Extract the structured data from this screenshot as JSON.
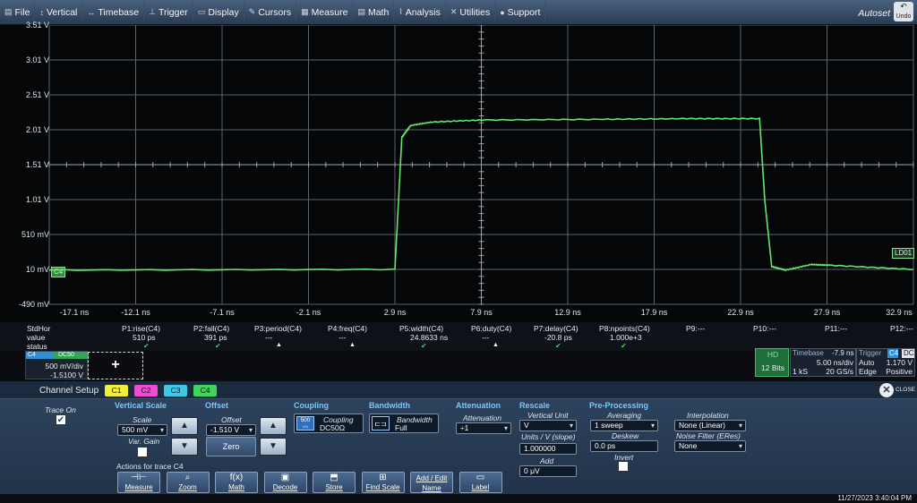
{
  "menubar": {
    "items": [
      {
        "icon": "file-icon",
        "glyph": "▤",
        "label": "File"
      },
      {
        "icon": "vertical-icon",
        "glyph": "↕",
        "label": "Vertical"
      },
      {
        "icon": "timebase-icon",
        "glyph": "↔",
        "label": "Timebase"
      },
      {
        "icon": "trigger-icon",
        "glyph": "⊥",
        "label": "Trigger"
      },
      {
        "icon": "display-icon",
        "glyph": "▭",
        "label": "Display"
      },
      {
        "icon": "cursors-icon",
        "glyph": "✎",
        "label": "Cursors"
      },
      {
        "icon": "measure-icon",
        "glyph": "▦",
        "label": "Measure"
      },
      {
        "icon": "math-icon",
        "glyph": "▤",
        "label": "Math"
      },
      {
        "icon": "analysis-icon",
        "glyph": "⌇",
        "label": "Analysis"
      },
      {
        "icon": "utilities-icon",
        "glyph": "✕",
        "label": "Utilities"
      },
      {
        "icon": "support-icon",
        "glyph": "●",
        "label": "Support"
      }
    ],
    "autoset": "Autoset",
    "undo": "Undo"
  },
  "grid": {
    "vlabels": [
      "3.51 V",
      "3.01 V",
      "2.51 V",
      "2.01 V",
      "1.51 V",
      "1.01 V",
      "510 mV",
      "10 mV",
      "-490 mV"
    ],
    "hlabels": [
      "-17.1 ns",
      "-12.1 ns",
      "-7.1 ns",
      "-2.1 ns",
      "2.9 ns",
      "7.9 ns",
      "12.9 ns",
      "17.9 ns",
      "22.9 ns",
      "27.9 ns",
      "32.9 ns"
    ],
    "trace_color": "#5fe86b",
    "marker_left": "C4",
    "marker_right": "LD01"
  },
  "trace": {
    "channel": "C4",
    "x_ns": [
      -17.1,
      2.9,
      3.3,
      3.8,
      5.0,
      7.9,
      15.0,
      20.0,
      24.0,
      24.3,
      24.7,
      25.5,
      27.0,
      28.0,
      32.9
    ],
    "y_v": [
      0.0,
      0.01,
      1.9,
      2.07,
      2.12,
      2.15,
      2.16,
      2.17,
      2.17,
      1.0,
      0.05,
      0.0,
      0.08,
      0.07,
      0.01
    ]
  },
  "measurements": {
    "row_labels": [
      "StdHor",
      "value",
      "status"
    ],
    "params": [
      {
        "name": "P1:rise(C4)",
        "value": "510 ps",
        "status": "check"
      },
      {
        "name": "P2:fall(C4)",
        "value": "391 ps",
        "status": "check"
      },
      {
        "name": "P3:period(C4)",
        "value": "---",
        "status": "triangle"
      },
      {
        "name": "P4:freq(C4)",
        "value": "---",
        "status": "triangle"
      },
      {
        "name": "P5:width(C4)",
        "value": "24.8633 ns",
        "status": "check"
      },
      {
        "name": "P6:duty(C4)",
        "value": "---",
        "status": "triangle"
      },
      {
        "name": "P7:delay(C4)",
        "value": "-20.8 ps",
        "status": "check"
      },
      {
        "name": "P8:npoints(C4)",
        "value": "1.000e+3",
        "status": "check"
      },
      {
        "name": "P9:---",
        "value": "",
        "status": ""
      },
      {
        "name": "P10:---",
        "value": "",
        "status": ""
      },
      {
        "name": "P11:---",
        "value": "",
        "status": ""
      },
      {
        "name": "P12:---",
        "value": "",
        "status": ""
      }
    ]
  },
  "channel_descriptor": {
    "name": "C4",
    "coupling": "DC50",
    "scale": "500 mV/div",
    "offset": "-1.5100 V",
    "add": "+"
  },
  "timebase": {
    "hd": "HD",
    "bits": "12 Bits",
    "title": "Timebase",
    "delay": "-7.9 ns",
    "per_div": "5.00 ns/div",
    "points": "1 kS",
    "rate": "20 GS/s",
    "trigger_title": "Trigger",
    "trigger_ch": "C4",
    "trigger_coupling": "DC",
    "trigger_mode": "Auto",
    "trigger_level": "1.170 V",
    "trigger_type": "Edge",
    "trigger_slope": "Positive"
  },
  "panel": {
    "title": "Channel Setup",
    "tabs": [
      {
        "label": "C1",
        "color": "#f2ef3a"
      },
      {
        "label": "C2",
        "color": "#f04bd6"
      },
      {
        "label": "C3",
        "color": "#3fc7e8"
      },
      {
        "label": "C4",
        "color": "#3fd45e"
      }
    ],
    "close_label": "CLOSE",
    "trace_on_label": "Trace On",
    "vertical_scale": {
      "title": "Vertical Scale",
      "scale_label": "Scale",
      "scale_value": "500 mV",
      "var_gain_label": "Var. Gain"
    },
    "offset": {
      "title": "Offset",
      "offset_label": "Offset",
      "offset_value": "-1.510 V",
      "zero_label": "Zero"
    },
    "coupling": {
      "title": "Coupling",
      "icon_label": "500",
      "label": "Coupling",
      "value": "DC50Ω"
    },
    "bandwidth": {
      "title": "Bandwidth",
      "label": "Bandwidth",
      "value": "Full"
    },
    "attenuation": {
      "title": "Attenuation",
      "label": "Attenuation",
      "value": "÷1"
    },
    "rescale": {
      "title": "Rescale",
      "unit_label": "Vertical Unit",
      "unit_value": "V",
      "slope_label": "Units / V (slope)",
      "slope_value": "1.000000",
      "add_label": "Add",
      "add_value": "0 μV"
    },
    "preprocessing": {
      "title": "Pre-Processing",
      "averaging_label": "Averaging",
      "averaging_value": "1 sweep",
      "deskew_label": "Deskew",
      "deskew_value": "0.0 ps",
      "invert_label": "Invert",
      "interp_label": "Interpolation",
      "interp_value": "None (Linear)",
      "noise_label": "Noise Filter (ERes)",
      "noise_value": "None"
    },
    "actions_label": "Actions for trace C4",
    "actions": [
      {
        "icon": "measure-icon",
        "glyph": "⊣⊢",
        "label": "Measure"
      },
      {
        "icon": "zoom-icon",
        "glyph": "⌕",
        "label": "Zoom"
      },
      {
        "icon": "math-icon",
        "glyph": "f(x)",
        "label": "Math"
      },
      {
        "icon": "decode-icon",
        "glyph": "▣",
        "label": "Decode"
      },
      {
        "icon": "store-icon",
        "glyph": "⬒",
        "label": "Store"
      },
      {
        "icon": "find-scale-icon",
        "glyph": "⊞",
        "label": "Find Scale"
      },
      {
        "icon": "add-edit-name-icon",
        "glyph": "",
        "label": "Add / Edit Name"
      },
      {
        "icon": "label-icon",
        "glyph": "▭",
        "label": "Label"
      }
    ]
  },
  "footer": {
    "datetime": "11/27/2023 3:40:04 PM"
  }
}
